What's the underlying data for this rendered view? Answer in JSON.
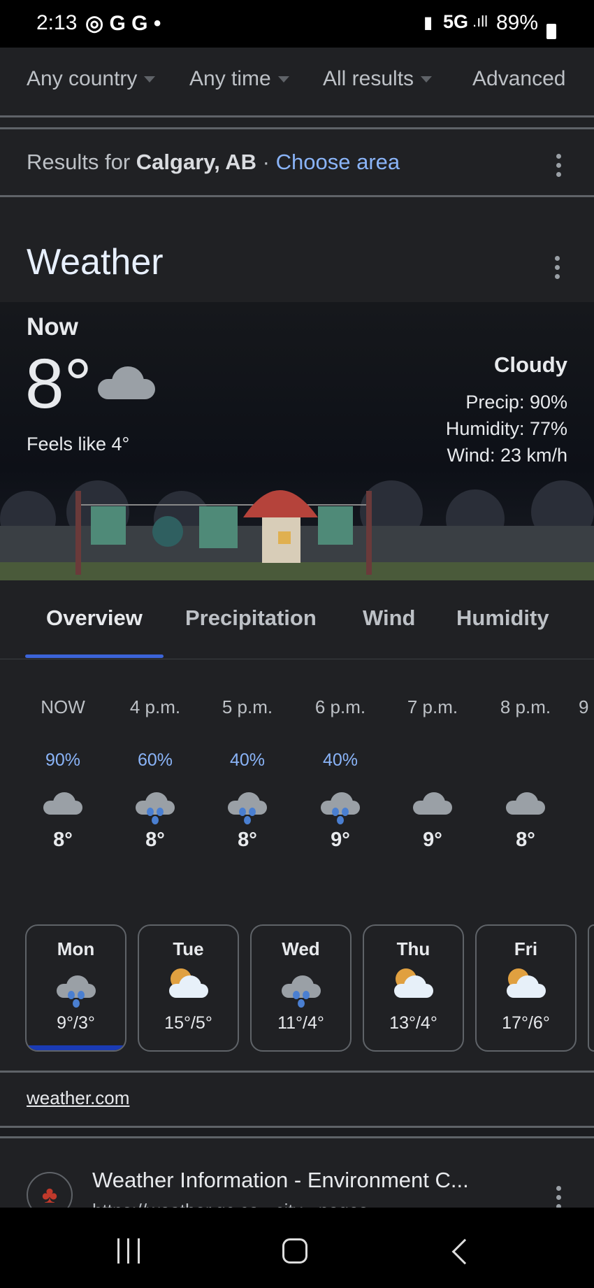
{
  "status_bar": {
    "time": "2:13",
    "notif_icons": [
      "chrome-icon",
      "google-icon",
      "google-icon",
      "dot"
    ],
    "network": "5G",
    "battery": "89%"
  },
  "filters": [
    {
      "label": "Any country"
    },
    {
      "label": "Any time"
    },
    {
      "label": "All results"
    },
    {
      "label": "Advanced"
    }
  ],
  "location": {
    "prefix": "Results for ",
    "city": "Calgary, AB",
    "separator": " · ",
    "choose": "Choose area"
  },
  "weather": {
    "title": "Weather",
    "now_label": "Now",
    "temp": "8°",
    "feels": "Feels like 4°",
    "condition": "Cloudy",
    "precip": "Precip: 90%",
    "humidity": "Humidity: 77%",
    "wind": "Wind: 23 km/h",
    "tabs": [
      {
        "label": "Overview",
        "active": true
      },
      {
        "label": "Precipitation"
      },
      {
        "label": "Wind"
      },
      {
        "label": "Humidity"
      }
    ],
    "hourly": [
      {
        "time": "NOW",
        "precip": "90%",
        "icon": "cloudy",
        "temp": "8°"
      },
      {
        "time": "4 p.m.",
        "precip": "60%",
        "icon": "rain",
        "temp": "8°"
      },
      {
        "time": "5 p.m.",
        "precip": "40%",
        "icon": "rain",
        "temp": "8°"
      },
      {
        "time": "6 p.m.",
        "precip": "40%",
        "icon": "rain",
        "temp": "9°"
      },
      {
        "time": "7 p.m.",
        "precip": "",
        "icon": "cloudy",
        "temp": "9°"
      },
      {
        "time": "8 p.m.",
        "precip": "",
        "icon": "cloudy",
        "temp": "8°"
      },
      {
        "time": "9",
        "precip": "",
        "icon": "",
        "temp": ""
      }
    ],
    "daily": [
      {
        "day": "Mon",
        "icon": "rain",
        "temps": "9°/3°",
        "selected": true
      },
      {
        "day": "Tue",
        "icon": "partly-cloudy",
        "temps": "15°/5°"
      },
      {
        "day": "Wed",
        "icon": "rain",
        "temps": "11°/4°"
      },
      {
        "day": "Thu",
        "icon": "partly-cloudy",
        "temps": "13°/4°"
      },
      {
        "day": "Fri",
        "icon": "partly-cloudy",
        "temps": "17°/6°"
      }
    ],
    "source": "weather.com"
  },
  "result": {
    "title": "Weather Information - Environment C...",
    "url": "https://weather.gc.ca › city › pages"
  },
  "colors": {
    "accent": "#8ab4f8",
    "tab_underline": "#3c64d8",
    "selected_day": "#1a3bb5"
  }
}
